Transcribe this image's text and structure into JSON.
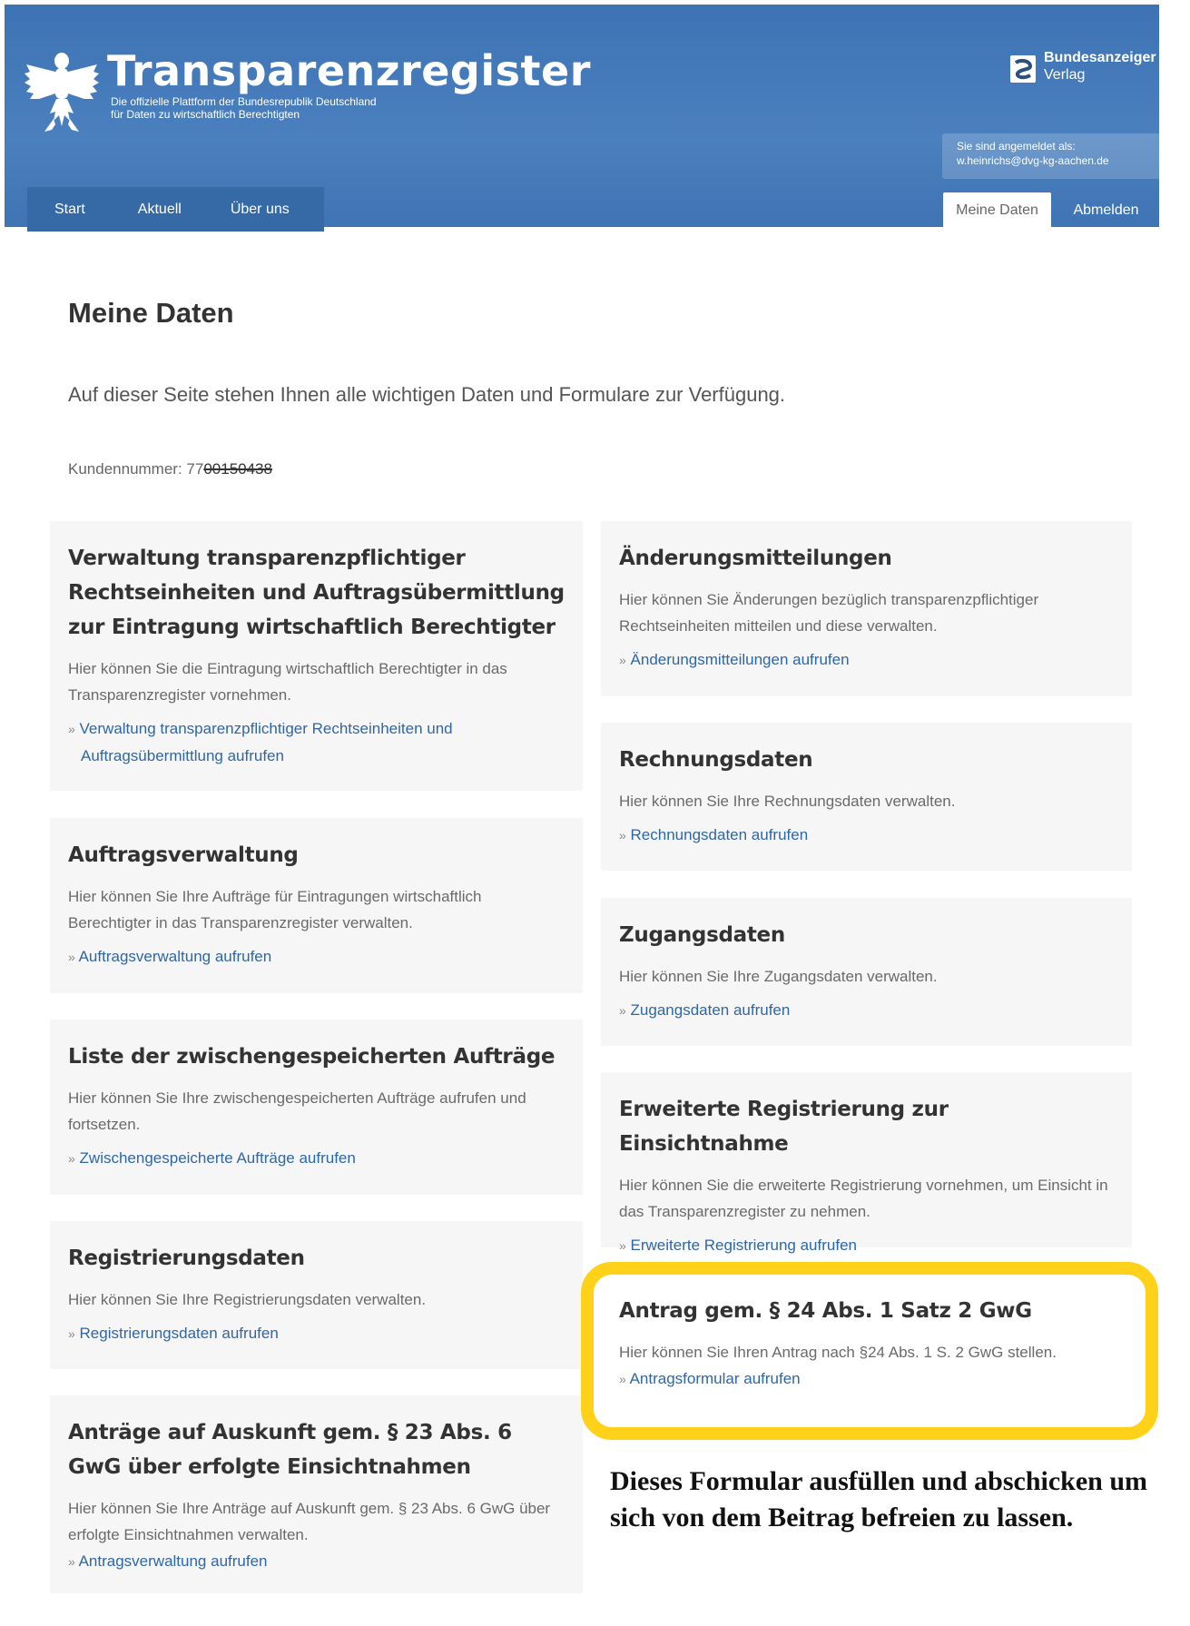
{
  "header": {
    "title": "Transparenzregister",
    "subtitle_line1": "Die offizielle Plattform der Bundesrepublik Deutschland",
    "subtitle_line2": "für Daten zu wirtschaftlich Berechtigten",
    "publisher_name": "Bundesanzeiger",
    "publisher_sub": "Verlag",
    "login_label": "Sie sind angemeldet als:",
    "login_user": "w.heinrichs@dvg-kg-aachen.de",
    "my_data_button": "Meine Daten",
    "logout_button": "Abmelden",
    "colors": {
      "header_bg": "#4378b8",
      "nav_bg": "#356aa6",
      "link": "#2e67a8",
      "highlight": "#ffd119"
    }
  },
  "nav": {
    "items": [
      "Start",
      "Aktuell",
      "Über uns"
    ]
  },
  "page": {
    "title": "Meine Daten",
    "intro": "Auf dieser Seite stehen Ihnen alle wichtigen Daten und Formulare zur Verfügung.",
    "customer_label": "Kundennummer: 77",
    "customer_number_struck": "00150438"
  },
  "cards_left": [
    {
      "title": "Verwaltung transparenzpflichtiger Rechtseinheiten und Auftragsübermittlung zur Eintragung wirtschaftlich Berechtigter",
      "text": "Hier können Sie die Eintragung wirtschaftlich Berechtigter in das Transparenzregister vornehmen.",
      "link": "Verwaltung transparenzpflichtiger Rechtseinheiten und Auftragsübermittlung aufrufen"
    },
    {
      "title": "Auftragsverwaltung",
      "text": "Hier können Sie Ihre Aufträge für Eintragungen wirtschaftlich Berechtigter in das Transparenzregister verwalten.",
      "link": "Auftragsverwaltung aufrufen"
    },
    {
      "title": "Liste der zwischengespeicherten Aufträge",
      "text": "Hier können Sie Ihre zwischengespeicherten Aufträge aufrufen und fortsetzen.",
      "link": "Zwischengespeicherte Aufträge aufrufen"
    },
    {
      "title": "Registrierungsdaten",
      "text": "Hier können Sie Ihre Registrierungsdaten verwalten.",
      "link": "Registrierungsdaten aufrufen"
    },
    {
      "title": "Anträge auf Auskunft gem. § 23 Abs. 6 GwG über erfolgte Einsichtnahmen",
      "text": "Hier können Sie Ihre Anträge auf Auskunft gem. § 23 Abs. 6 GwG über erfolgte Einsichtnahmen verwalten.",
      "link": "Antragsverwaltung aufrufen"
    }
  ],
  "cards_right": [
    {
      "title": "Änderungsmitteilungen",
      "text": "Hier können Sie Änderungen bezüglich transparenzpflichtiger Rechtseinheiten mitteilen und diese verwalten.",
      "link": "Änderungsmitteilungen aufrufen"
    },
    {
      "title": "Rechnungsdaten",
      "text": "Hier können Sie Ihre Rechnungsdaten verwalten.",
      "link": "Rechnungsdaten aufrufen"
    },
    {
      "title": "Zugangsdaten",
      "text": "Hier können Sie Ihre Zugangsdaten verwalten.",
      "link": "Zugangsdaten aufrufen"
    },
    {
      "title": "Erweiterte Registrierung zur Einsichtnahme",
      "text": "Hier können Sie die erweiterte Registrierung vornehmen, um Einsicht in das Transparenzregister zu nehmen.",
      "link": "Erweiterte Registrierung aufrufen"
    },
    {
      "title": "Antrag gem. § 24 Abs. 1 Satz 2 GwG",
      "text": "Hier können Sie Ihren Antrag nach §24 Abs. 1 S. 2 GwG stellen.",
      "link": "Antragsformular aufrufen"
    }
  ],
  "annotation": {
    "text": "Dieses Formular ausfüllen und abschicken um sich von dem Beitrag befreien zu lassen."
  },
  "icons": {
    "link_prefix": "»"
  }
}
